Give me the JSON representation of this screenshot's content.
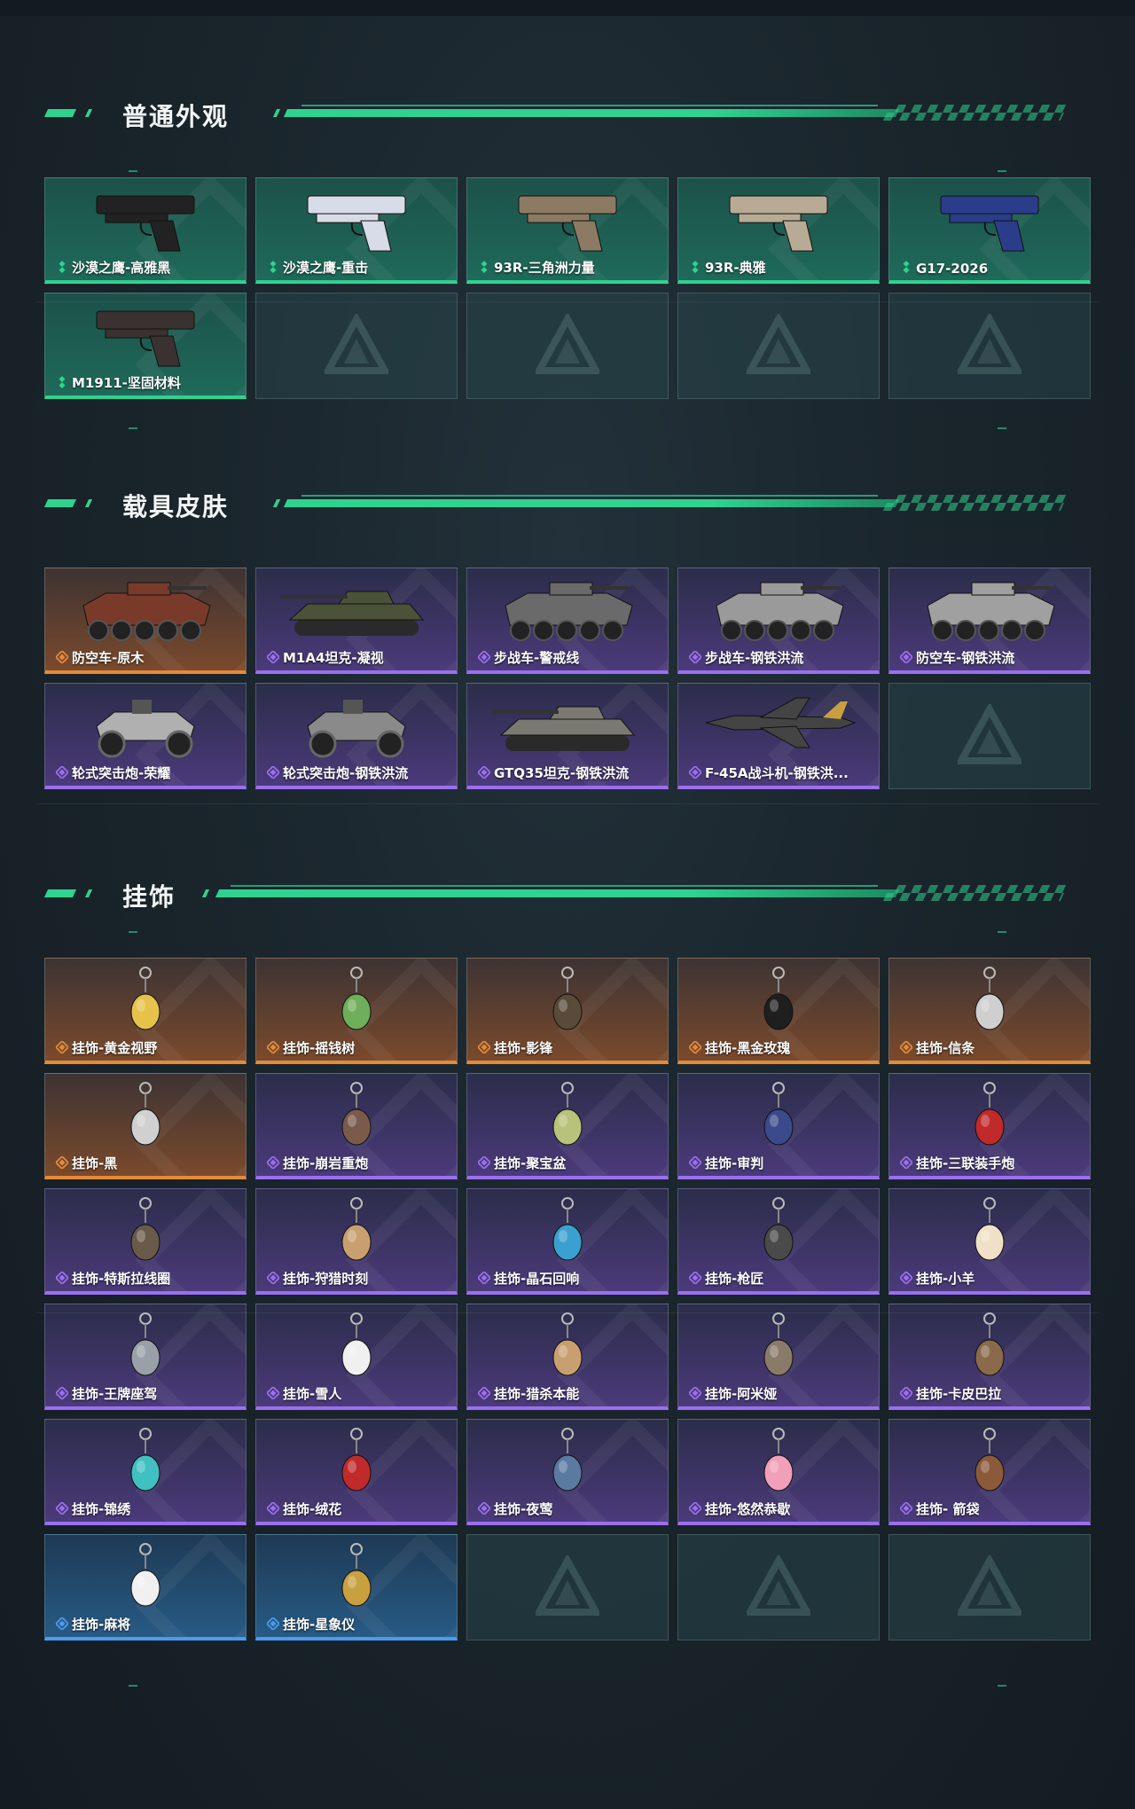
{
  "sections": {
    "skins": {
      "title": "普通外观",
      "items": [
        {
          "label": "沙漠之鹰-高雅黑",
          "rarity": "green",
          "kind": "pistol",
          "color": "#222222"
        },
        {
          "label": "沙漠之鹰-重击",
          "rarity": "green",
          "kind": "pistol",
          "color": "#d8dbe8"
        },
        {
          "label": "93R-三角洲力量",
          "rarity": "green",
          "kind": "pistol",
          "color": "#8c7a62"
        },
        {
          "label": "93R-典雅",
          "rarity": "green",
          "kind": "pistol",
          "color": "#b8ab96"
        },
        {
          "label": "G17-2026",
          "rarity": "green",
          "kind": "pistol",
          "color": "#2a3d8a"
        },
        {
          "label": "M1911-坚固材料",
          "rarity": "green",
          "kind": "pistol",
          "color": "#3a3230"
        }
      ],
      "empty_slots": 4
    },
    "vehicles": {
      "title": "载具皮肤",
      "items": [
        {
          "label": "防空车-原木",
          "rarity": "orange",
          "kind": "apc",
          "color": "#7a3a2a"
        },
        {
          "label": "M1A4坦克-凝视",
          "rarity": "purple",
          "kind": "tank",
          "color": "#4a5238"
        },
        {
          "label": "步战车-警戒线",
          "rarity": "purple",
          "kind": "apc",
          "color": "#6a6a6a"
        },
        {
          "label": "步战车-钢铁洪流",
          "rarity": "purple",
          "kind": "apc",
          "color": "#9a9a9a"
        },
        {
          "label": "防空车-钢铁洪流",
          "rarity": "purple",
          "kind": "apc",
          "color": "#a0a0a0"
        },
        {
          "label": "轮式突击炮-荣耀",
          "rarity": "purple",
          "kind": "buggy",
          "color": "#b0b0b0"
        },
        {
          "label": "轮式突击炮-钢铁洪流",
          "rarity": "purple",
          "kind": "buggy",
          "color": "#8a8a8a"
        },
        {
          "label": "GTQ35坦克-钢铁洪流",
          "rarity": "purple",
          "kind": "tank",
          "color": "#7a7a72"
        },
        {
          "label": "F-45A战斗机-钢铁洪...",
          "rarity": "purple",
          "kind": "jet",
          "color": "#444444"
        }
      ],
      "empty_slots": 1
    },
    "charms": {
      "title": "挂饰",
      "items": [
        {
          "label": "挂饰-黄金视野",
          "rarity": "orange",
          "color": "#e6c24a"
        },
        {
          "label": "挂饰-摇钱树",
          "rarity": "orange",
          "color": "#6fae5a"
        },
        {
          "label": "挂饰-影锋",
          "rarity": "orange",
          "color": "#5a4a3a"
        },
        {
          "label": "挂饰-黑金玫瑰",
          "rarity": "orange",
          "color": "#1f1f1f"
        },
        {
          "label": "挂饰-信条",
          "rarity": "orange",
          "color": "#cfcfcf"
        },
        {
          "label": "挂饰-黑",
          "rarity": "orange",
          "color": "#d0d0d0"
        },
        {
          "label": "挂饰-崩岩重炮",
          "rarity": "purple",
          "color": "#7a5a4a"
        },
        {
          "label": "挂饰-聚宝盆",
          "rarity": "purple",
          "color": "#b8c27a"
        },
        {
          "label": "挂饰-审判",
          "rarity": "purple",
          "color": "#3a4a8a"
        },
        {
          "label": "挂饰-三联装手炮",
          "rarity": "purple",
          "color": "#c02a2a"
        },
        {
          "label": "挂饰-特斯拉线圈",
          "rarity": "purple",
          "color": "#6a5a4a"
        },
        {
          "label": "挂饰-狩猎时刻",
          "rarity": "purple",
          "color": "#c8a070"
        },
        {
          "label": "挂饰-晶石回响",
          "rarity": "purple",
          "color": "#3aa0d0"
        },
        {
          "label": "挂饰-枪匠",
          "rarity": "purple",
          "color": "#4a4a4a"
        },
        {
          "label": "挂饰-小羊",
          "rarity": "purple",
          "color": "#f0e0c8"
        },
        {
          "label": "挂饰-王牌座驾",
          "rarity": "purple",
          "color": "#9aa0a8"
        },
        {
          "label": "挂饰-雪人",
          "rarity": "purple",
          "color": "#f0f0f0"
        },
        {
          "label": "挂饰-猎杀本能",
          "rarity": "purple",
          "color": "#c8a070"
        },
        {
          "label": "挂饰-阿米娅",
          "rarity": "purple",
          "color": "#8a7a6a"
        },
        {
          "label": "挂饰-卡皮巴拉",
          "rarity": "purple",
          "color": "#8a6a4a"
        },
        {
          "label": "挂饰-锦绣",
          "rarity": "purple",
          "color": "#40c0c0"
        },
        {
          "label": "挂饰-绒花",
          "rarity": "purple",
          "color": "#c02a2a"
        },
        {
          "label": "挂饰-夜莺",
          "rarity": "purple",
          "color": "#5a7aa0"
        },
        {
          "label": "挂饰-悠然恭歇",
          "rarity": "purple",
          "color": "#f0a0b8"
        },
        {
          "label": "挂饰- 箭袋",
          "rarity": "purple",
          "color": "#8a5a3a"
        },
        {
          "label": "挂饰-麻将",
          "rarity": "blue",
          "color": "#f0f0f0"
        },
        {
          "label": "挂饰-星象仪",
          "rarity": "blue",
          "color": "#c8a040"
        }
      ],
      "empty_slots": 3
    }
  },
  "colors": {
    "accent": "#2fd28f",
    "green": "#2fd28f",
    "orange": "#e58a3a",
    "purple": "#9a6ff0",
    "blue": "#4a9cf0"
  }
}
